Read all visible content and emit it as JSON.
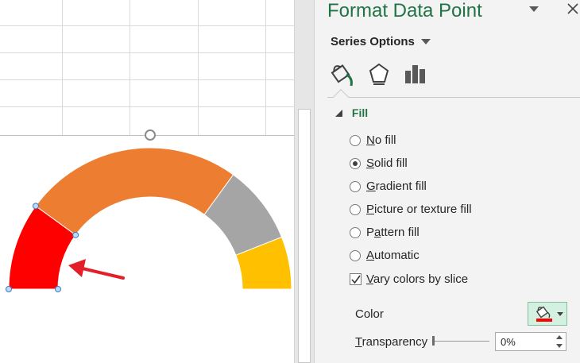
{
  "pane": {
    "title": "Format Data Point",
    "menu_icon": "dropdown-triangle-icon",
    "close_icon": "close-icon",
    "series_options_label": "Series Options",
    "tabs": [
      {
        "name": "fill-line",
        "icon": "paint-bucket-icon"
      },
      {
        "name": "effects",
        "icon": "pentagon-icon"
      },
      {
        "name": "series-options",
        "icon": "bar-chart-icon"
      }
    ],
    "fill": {
      "header": "Fill",
      "options": [
        {
          "prefix": "",
          "accel": "N",
          "rest": "o fill",
          "selected": false
        },
        {
          "prefix": "",
          "accel": "S",
          "rest": "olid fill",
          "selected": true
        },
        {
          "prefix": "",
          "accel": "G",
          "rest": "radient fill",
          "selected": false
        },
        {
          "prefix": "",
          "accel": "P",
          "rest": "icture or texture fill",
          "selected": false
        },
        {
          "prefix": "P",
          "accel": "a",
          "rest": "ttern fill",
          "selected": false
        },
        {
          "prefix": "",
          "accel": "A",
          "rest": "utomatic",
          "selected": false
        }
      ],
      "vary_colors": {
        "accel": "V",
        "rest": "ary colors by slice",
        "checked": true
      },
      "color_label": "Color",
      "transparency": {
        "accel": "T",
        "rest": "ransparency",
        "value": "0%",
        "slider_fraction": 0
      }
    }
  },
  "chart_data": {
    "type": "pie",
    "variant": "half-doughnut gauge",
    "slices": [
      {
        "value": 20,
        "color": "#ff0000",
        "selected": true
      },
      {
        "value": 50,
        "color": "#ed7d31"
      },
      {
        "value": 18,
        "color": "#a5a5a5"
      },
      {
        "value": 12,
        "color": "#ffc000"
      }
    ],
    "start_angle_deg": 180,
    "span_deg": 180
  },
  "colors": {
    "accent": "#217346",
    "annotation_arrow": "#e3202a",
    "selected_fill": "#ff0000"
  }
}
